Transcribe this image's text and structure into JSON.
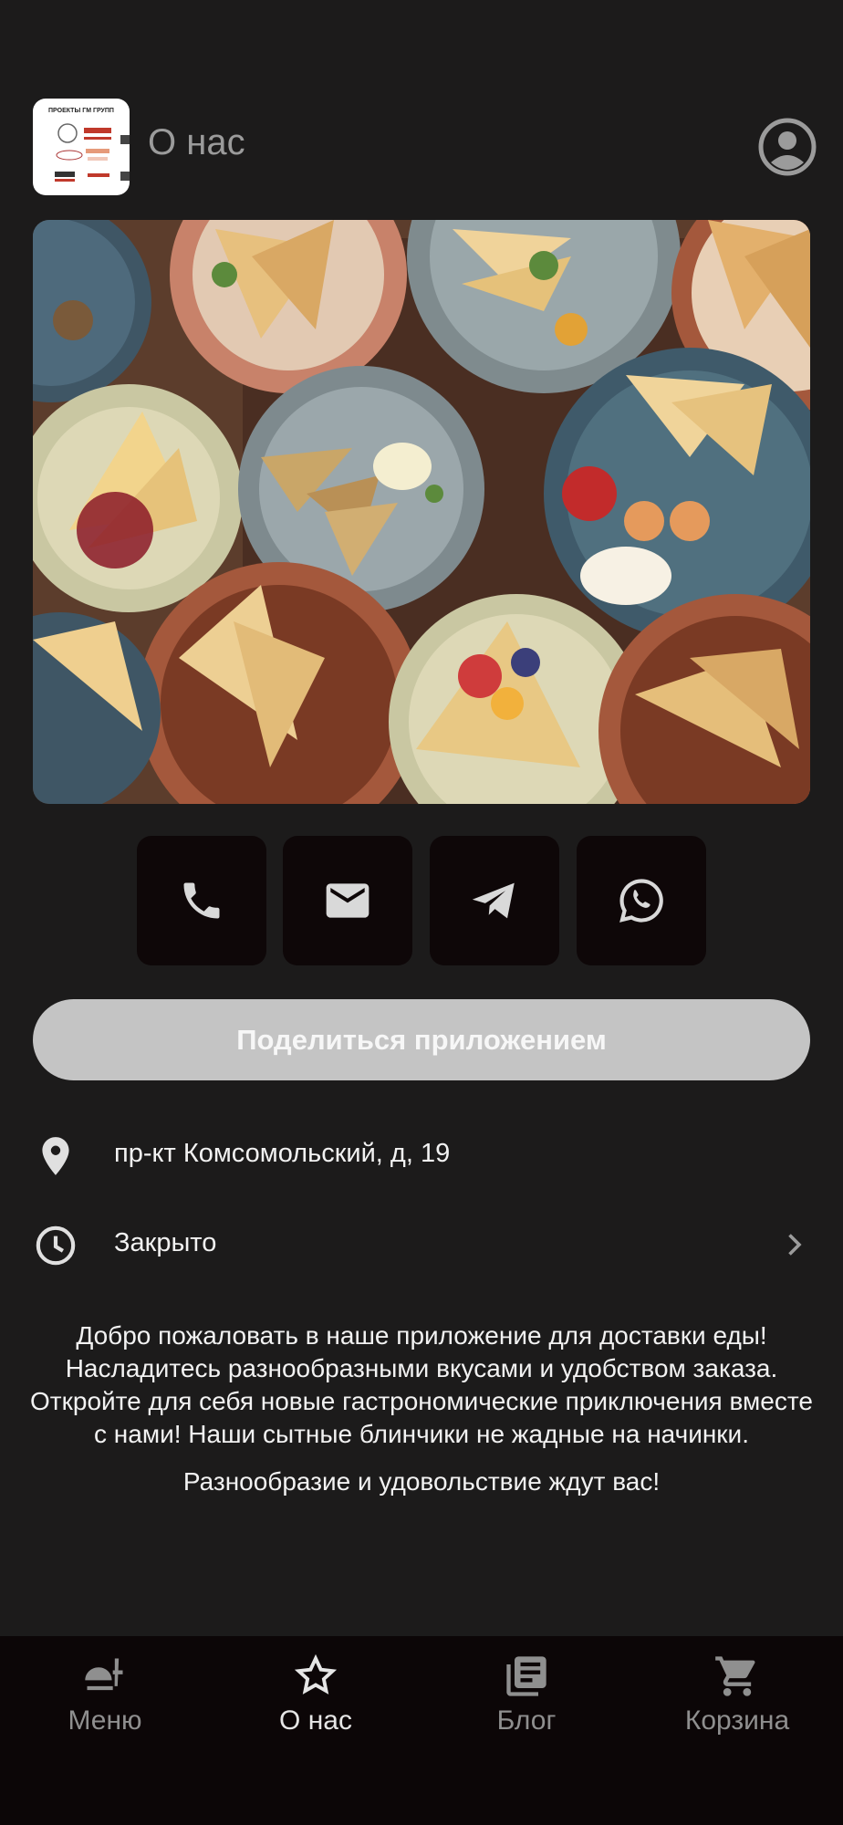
{
  "header": {
    "title": "О нас",
    "logo_text": "ПРОЕКТЫ ГМ ГРУПП"
  },
  "contacts": [
    {
      "icon": "phone-icon"
    },
    {
      "icon": "mail-icon"
    },
    {
      "icon": "telegram-icon"
    },
    {
      "icon": "whatsapp-icon"
    }
  ],
  "share_label": "Поделиться приложением",
  "address": "пр-кт Комсомольский, д, 19",
  "hours_status": "Закрыто",
  "about": {
    "paragraph1": "Добро пожаловать в наше приложение для доставки еды! Насладитесь разнообразными вкусами и удобством заказа. Откройте для себя новые гастрономические приключения вместе с нами! Наши сытные блинчики не жадные на начинки.",
    "paragraph2": "Разнообразие и удовольствие ждут вас!"
  },
  "nav": {
    "menu": "Меню",
    "about": "О нас",
    "blog": "Блог",
    "cart": "Корзина"
  },
  "colors": {
    "background": "#1c1b1b",
    "button_dark": "#0e0708",
    "share_button": "#c4c4c4",
    "bottom_nav": "#0c0607"
  }
}
